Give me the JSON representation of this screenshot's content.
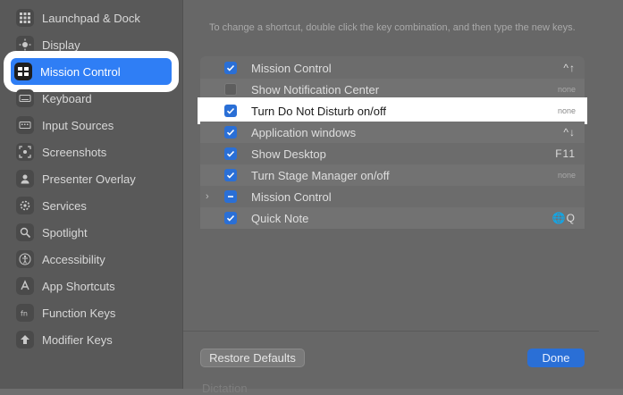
{
  "sidebar": {
    "items": [
      {
        "label": "Launchpad & Dock",
        "icon": "launchpad-dock-icon"
      },
      {
        "label": "Display",
        "icon": "display-icon"
      },
      {
        "label": "Mission Control",
        "icon": "mission-control-icon",
        "selected": true
      },
      {
        "label": "Keyboard",
        "icon": "keyboard-icon"
      },
      {
        "label": "Input Sources",
        "icon": "input-sources-icon"
      },
      {
        "label": "Screenshots",
        "icon": "screenshots-icon"
      },
      {
        "label": "Presenter Overlay",
        "icon": "presenter-overlay-icon"
      },
      {
        "label": "Services",
        "icon": "services-icon"
      },
      {
        "label": "Spotlight",
        "icon": "spotlight-icon"
      },
      {
        "label": "Accessibility",
        "icon": "accessibility-icon"
      },
      {
        "label": "App Shortcuts",
        "icon": "app-shortcuts-icon"
      },
      {
        "label": "Function Keys",
        "icon": "function-keys-icon"
      },
      {
        "label": "Modifier Keys",
        "icon": "modifier-keys-icon"
      }
    ]
  },
  "main": {
    "hint": "To change a shortcut, double click the key combination, and then type the new keys.",
    "shortcuts": [
      {
        "label": "Mission Control",
        "checked": "on",
        "key": "^↑"
      },
      {
        "label": "Show Notification Center",
        "checked": "off",
        "key": "none"
      },
      {
        "label": "Turn Do Not Disturb on/off",
        "checked": "on",
        "key": "none",
        "highlighted": true
      },
      {
        "label": "Application windows",
        "checked": "on",
        "key": "^↓"
      },
      {
        "label": "Show Desktop",
        "checked": "on",
        "key": "F11"
      },
      {
        "label": "Turn Stage Manager on/off",
        "checked": "on",
        "key": "none"
      },
      {
        "label": "Mission Control",
        "checked": "mixed",
        "key": "",
        "expandable": true
      },
      {
        "label": "Quick Note",
        "checked": "on",
        "key": "🌐Q"
      }
    ],
    "restore_label": "Restore Defaults",
    "done_label": "Done",
    "dictation_label": "Dictation"
  },
  "colors": {
    "accent": "#2f7ef5",
    "checkbox_on": "#2a6fd6",
    "highlight_ring": "#ffffff"
  }
}
